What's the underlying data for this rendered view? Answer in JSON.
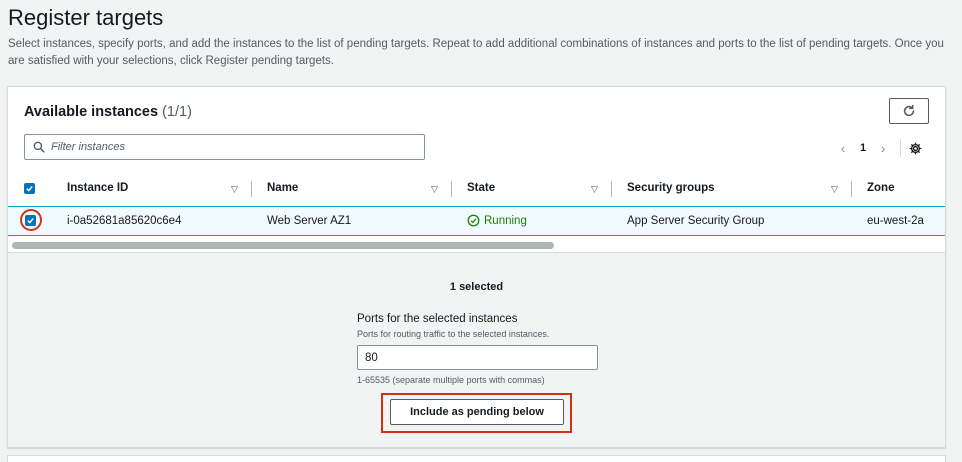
{
  "header": {
    "title": "Register targets",
    "description": "Select instances, specify ports, and add the instances to the list of pending targets. Repeat to add additional combinations of instances and ports to the list of pending targets. Once you are satisfied with your selections, click Register pending targets."
  },
  "panel": {
    "title": "Available instances",
    "count": "(1/1)",
    "refresh_icon": "refresh-icon",
    "filter_placeholder": "Filter instances",
    "pagination": {
      "prev": "‹",
      "page": "1",
      "next": "›"
    },
    "settings_icon": "gear-icon"
  },
  "table": {
    "columns": [
      "Instance ID",
      "Name",
      "State",
      "Security groups",
      "Zone"
    ],
    "rows": [
      {
        "selected": true,
        "instance_id": "i-0a52681a85620c6e4",
        "name": "Web Server AZ1",
        "state": "Running",
        "security_groups": "App Server Security Group",
        "zone": "eu-west-2a"
      }
    ]
  },
  "selection": {
    "summary": "1 selected",
    "ports_label": "Ports for the selected instances",
    "ports_description": "Ports for routing traffic to the selected instances.",
    "ports_value": "80",
    "ports_hint": "1-65535 (separate multiple ports with commas)",
    "include_button": "Include as pending below"
  },
  "colors": {
    "accent": "#0073bb",
    "running": "#1d8102",
    "highlight": "#d13212"
  }
}
